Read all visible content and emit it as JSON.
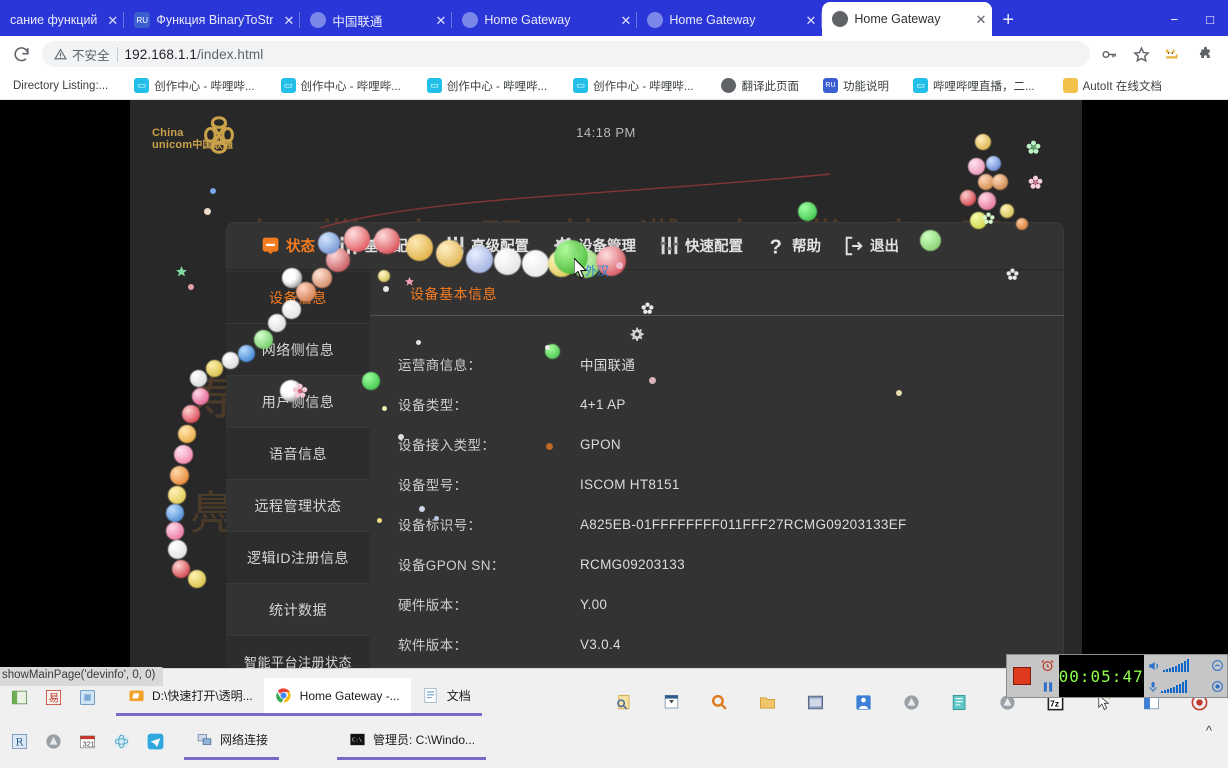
{
  "browser": {
    "tabs": [
      {
        "title": "сание функций",
        "favicon": "none",
        "active": false
      },
      {
        "title": "Функция BinaryToStr",
        "favicon": "ru-icon",
        "active": false
      },
      {
        "title": "中国联通",
        "favicon": "globe-icon",
        "active": false
      },
      {
        "title": "Home Gateway",
        "favicon": "globe-icon",
        "active": false
      },
      {
        "title": "Home Gateway",
        "favicon": "globe-icon",
        "active": false
      },
      {
        "title": "Home Gateway",
        "favicon": "globe-icon",
        "active": true
      }
    ],
    "new_tab_label": "+",
    "window_minimize": "−",
    "window_maximize": "□",
    "reload_icon": "reload-icon",
    "security_label": "不安全",
    "url_host": "192.168.1.1",
    "url_path": "/index.html",
    "toolbar_icons": [
      "key-icon",
      "star-icon",
      "cat-extension-icon",
      "puzzle-extension-icon"
    ],
    "bookmarks": [
      {
        "label": "Directory Listing:...",
        "icon": "none"
      },
      {
        "label": "创作中心 - 哔哩哔...",
        "icon": "bilibili-icon"
      },
      {
        "label": "创作中心 - 哔哩哔...",
        "icon": "bilibili-icon"
      },
      {
        "label": "创作中心 - 哔哩哔...",
        "icon": "bilibili-icon"
      },
      {
        "label": "创作中心 - 哔哩哔...",
        "icon": "bilibili-icon"
      },
      {
        "label": "翻译此页面",
        "icon": "globe-icon"
      },
      {
        "label": "功能说明",
        "icon": "ru-icon"
      },
      {
        "label": "哔哩哔哩直播，二...",
        "icon": "bilibili-icon"
      },
      {
        "label": "AutoIt 在线文档",
        "icon": "autoit-icon"
      }
    ]
  },
  "router": {
    "brand_en_line1": "China",
    "brand_en_line2": "unicom",
    "brand_cn": "中国联通",
    "clock": "14:18 PM",
    "nav": [
      {
        "label": "状态",
        "icon": "status-icon",
        "active": true
      },
      {
        "label": "基础配置",
        "icon": "sliders-icon",
        "active": false
      },
      {
        "label": "高级配置",
        "icon": "sliders-icon",
        "active": false
      },
      {
        "label": "设备管理",
        "icon": "gear-icon",
        "active": false
      },
      {
        "label": "快速配置",
        "icon": "sliders-icon",
        "active": false
      },
      {
        "label": "帮助",
        "icon": "question-icon",
        "active": false
      },
      {
        "label": "退出",
        "icon": "exit-icon",
        "active": false
      }
    ],
    "sidebar": [
      {
        "label": "设备信息",
        "active": true
      },
      {
        "label": "网络侧信息",
        "active": false
      },
      {
        "label": "用户侧信息",
        "active": false
      },
      {
        "label": "语音信息",
        "active": false
      },
      {
        "label": "远程管理状态",
        "active": false
      },
      {
        "label": "逻辑ID注册信息",
        "active": false
      },
      {
        "label": "统计数据",
        "active": false
      },
      {
        "label": "智能平台注册状态",
        "active": false
      }
    ],
    "subtabs": [
      {
        "label": "设备基本信息",
        "active": true
      }
    ],
    "device_info": [
      {
        "label": "运营商信息：",
        "value": "中国联通"
      },
      {
        "label": "设备类型：",
        "value": "4+1 AP"
      },
      {
        "label": "设备接入类型：",
        "value": "GPON"
      },
      {
        "label": "设备型号：",
        "value": "ISCOM HT8151"
      },
      {
        "label": "设备标识号：",
        "value": "A825EB-01FFFFFFFF011FFF27RCMG09203133EF"
      },
      {
        "label": "设备GPON SN：",
        "value": "RCMG09203133"
      },
      {
        "label": "硬件版本：",
        "value": "Y.00"
      },
      {
        "label": "软件版本：",
        "value": "V3.0.4"
      }
    ],
    "watermark_chars": [
      "寿",
      "業",
      "鳧",
      "門",
      "外",
      "灘",
      "寿",
      "業",
      "鳧",
      "門",
      "外",
      "灘"
    ],
    "colors": {
      "accent": "#f47b20",
      "panel_bg": "#333333",
      "page_bg": "#2e2e2e",
      "brand_gold": "#c9a24a"
    }
  },
  "status_bubble": {
    "text": "showMainPage('devinfo', 0, 0)"
  },
  "recorder": {
    "elapsed": "00:05:47",
    "stop_label": "stop-button",
    "alarm_label": "alarm-icon",
    "pause_label": "pause-icon",
    "speaker_label": "speaker-icon",
    "mic_label": "microphone-icon"
  },
  "taskbar": {
    "row1_quick_icons": [
      "window-icon",
      "stamp-icon",
      "package-icon"
    ],
    "row1_buttons": [
      {
        "label": "D:\\快速打开\\透明...",
        "icon": "folder-icon",
        "selected": false
      },
      {
        "label": "Home Gateway -...",
        "icon": "chrome-icon",
        "selected": true
      },
      {
        "label": "文档",
        "icon": "document-icon",
        "selected": false
      }
    ],
    "row2_quick_icons": [
      "r-icon",
      "app-icon",
      "calendar-icon",
      "atom-icon",
      "telegram-icon"
    ],
    "row2_buttons": [
      {
        "label": "网络连接",
        "icon": "network-icon",
        "selected": false
      },
      {
        "label": "管理员: C:\\Windo...",
        "icon": "console-icon",
        "selected": false
      }
    ],
    "tray_icons": [
      "magnify-doc-icon",
      "hourglass-icon",
      "search-icon",
      "folder-icon",
      "media-icon",
      "blue-person-icon",
      "app-gray-icon",
      "notebook-icon",
      "app-gray-icon",
      "7z-icon",
      "mouse-icon",
      "panel-icon",
      "record-icon"
    ],
    "tray_arrow": "^"
  }
}
